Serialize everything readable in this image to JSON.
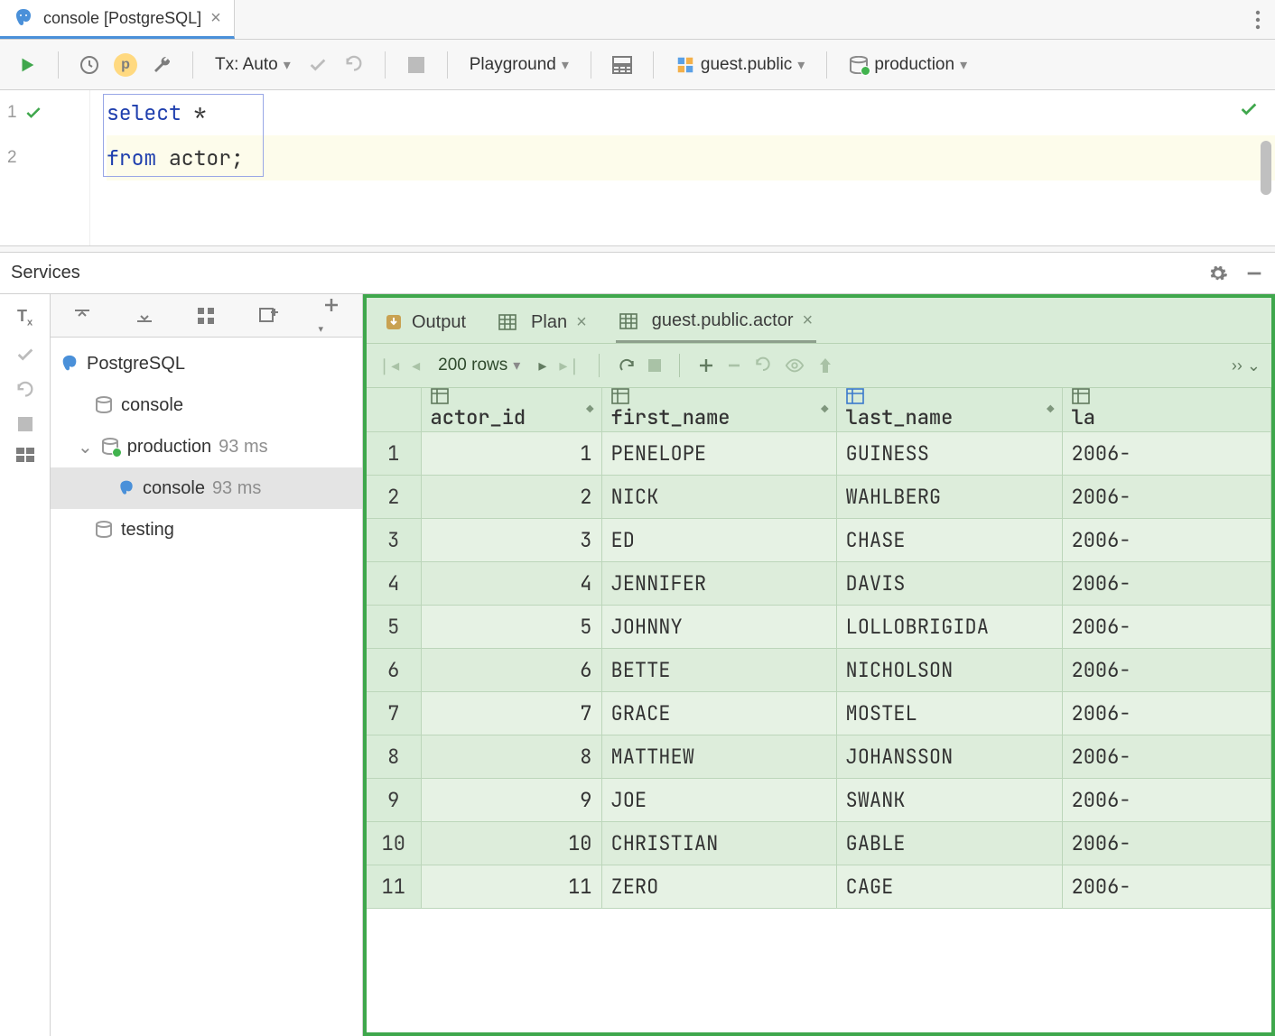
{
  "tab": {
    "title": "console [PostgreSQL]"
  },
  "toolbar": {
    "tx": "Tx: Auto",
    "playground": "Playground",
    "schema": "guest.public",
    "datasource": "production"
  },
  "editor": {
    "lines": [
      {
        "num": "1",
        "kw": "select",
        "rest": " *"
      },
      {
        "num": "2",
        "kw": "from",
        "rest": " actor",
        "tail": ";"
      }
    ]
  },
  "services": {
    "title": "Services",
    "tree": {
      "root": "PostgreSQL",
      "console": "console",
      "production": "production",
      "production_ms": "93 ms",
      "prod_console": "console",
      "prod_console_ms": "93 ms",
      "testing": "testing"
    },
    "result_tabs": {
      "output": "Output",
      "plan": "Plan",
      "table": "guest.public.actor"
    },
    "page_label": "200 rows",
    "columns": [
      "actor_id",
      "first_name",
      "last_name",
      "la"
    ],
    "rows": [
      {
        "n": 1,
        "id": 1,
        "first": "PENELOPE",
        "last": "GUINESS",
        "upd": "2006-"
      },
      {
        "n": 2,
        "id": 2,
        "first": "NICK",
        "last": "WAHLBERG",
        "upd": "2006-"
      },
      {
        "n": 3,
        "id": 3,
        "first": "ED",
        "last": "CHASE",
        "upd": "2006-"
      },
      {
        "n": 4,
        "id": 4,
        "first": "JENNIFER",
        "last": "DAVIS",
        "upd": "2006-"
      },
      {
        "n": 5,
        "id": 5,
        "first": "JOHNNY",
        "last": "LOLLOBRIGIDA",
        "upd": "2006-"
      },
      {
        "n": 6,
        "id": 6,
        "first": "BETTE",
        "last": "NICHOLSON",
        "upd": "2006-"
      },
      {
        "n": 7,
        "id": 7,
        "first": "GRACE",
        "last": "MOSTEL",
        "upd": "2006-"
      },
      {
        "n": 8,
        "id": 8,
        "first": "MATTHEW",
        "last": "JOHANSSON",
        "upd": "2006-"
      },
      {
        "n": 9,
        "id": 9,
        "first": "JOE",
        "last": "SWANK",
        "upd": "2006-"
      },
      {
        "n": 10,
        "id": 10,
        "first": "CHRISTIAN",
        "last": "GABLE",
        "upd": "2006-"
      },
      {
        "n": 11,
        "id": 11,
        "first": "ZERO",
        "last": "CAGE",
        "upd": "2006-"
      }
    ]
  }
}
